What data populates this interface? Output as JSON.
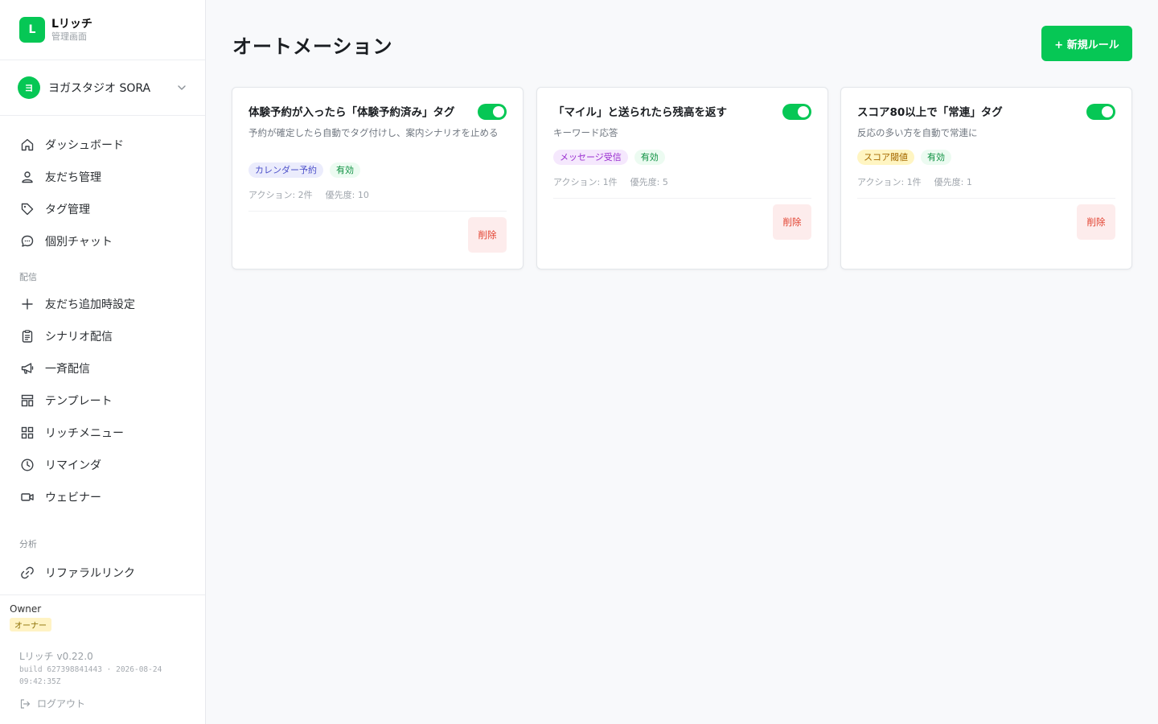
{
  "brand": {
    "logo_letter": "L",
    "name": "Lリッチ",
    "subtitle": "管理画面"
  },
  "account": {
    "avatar_letter": "ヨ",
    "name": "ヨガスタジオ SORA"
  },
  "nav": {
    "main": [
      {
        "label": "ダッシュボード",
        "icon": "home-icon"
      },
      {
        "label": "友だち管理",
        "icon": "users-icon"
      },
      {
        "label": "タグ管理",
        "icon": "tag-icon"
      },
      {
        "label": "個別チャット",
        "icon": "chat-icon"
      }
    ],
    "section_delivery": "配信",
    "delivery": [
      {
        "label": "友だち追加時設定",
        "icon": "plus-icon"
      },
      {
        "label": "シナリオ配信",
        "icon": "clipboard-icon"
      },
      {
        "label": "一斉配信",
        "icon": "megaphone-icon"
      },
      {
        "label": "テンプレート",
        "icon": "template-icon"
      },
      {
        "label": "リッチメニュー",
        "icon": "grid-icon"
      },
      {
        "label": "リマインダ",
        "icon": "clock-icon"
      },
      {
        "label": "ウェビナー",
        "icon": "video-icon"
      }
    ],
    "section_analytics": "分析",
    "analytics": [
      {
        "label": "リファラルリンク",
        "icon": "link-icon"
      }
    ]
  },
  "owner": {
    "name": "Owner",
    "role_badge": "オーナー"
  },
  "version": {
    "name": "Lリッチ v0.22.0",
    "build": "build 627398841443 · 2026-08-24 09:42:35Z"
  },
  "logout_label": "ログアウト",
  "page": {
    "title": "オートメーション",
    "new_button": "+ 新規ルール"
  },
  "colors": {
    "accent": "#06c755",
    "danger": "#e2412f"
  },
  "cards": [
    {
      "title": "体験予約が入ったら「体験予約済み」タグ",
      "enabled": true,
      "description": "予約が確定したら自動でタグ付けし、案内シナリオを止める",
      "trigger_tag": "カレンダー予約",
      "trigger_color": "#4b4fc9",
      "trigger_bg": "#ebecfc",
      "status": "有効",
      "actions": "アクション: 2件",
      "priority": "優先度: 10",
      "delete_label": "削除"
    },
    {
      "title": "「マイル」と送られたら残高を返す",
      "enabled": true,
      "description": "キーワード応答",
      "trigger_tag": "メッセージ受信",
      "trigger_color": "#9a2fd0",
      "trigger_bg": "#f5e8fd",
      "status": "有効",
      "actions": "アクション: 1件",
      "priority": "優先度: 5",
      "delete_label": "削除"
    },
    {
      "title": "スコア80以上で「常連」タグ",
      "enabled": true,
      "description": "反応の多い方を自動で常連に",
      "trigger_tag": "スコア閾値",
      "trigger_color": "#a66a00",
      "trigger_bg": "#fff5c2",
      "status": "有効",
      "actions": "アクション: 1件",
      "priority": "優先度: 1",
      "delete_label": "削除"
    }
  ]
}
